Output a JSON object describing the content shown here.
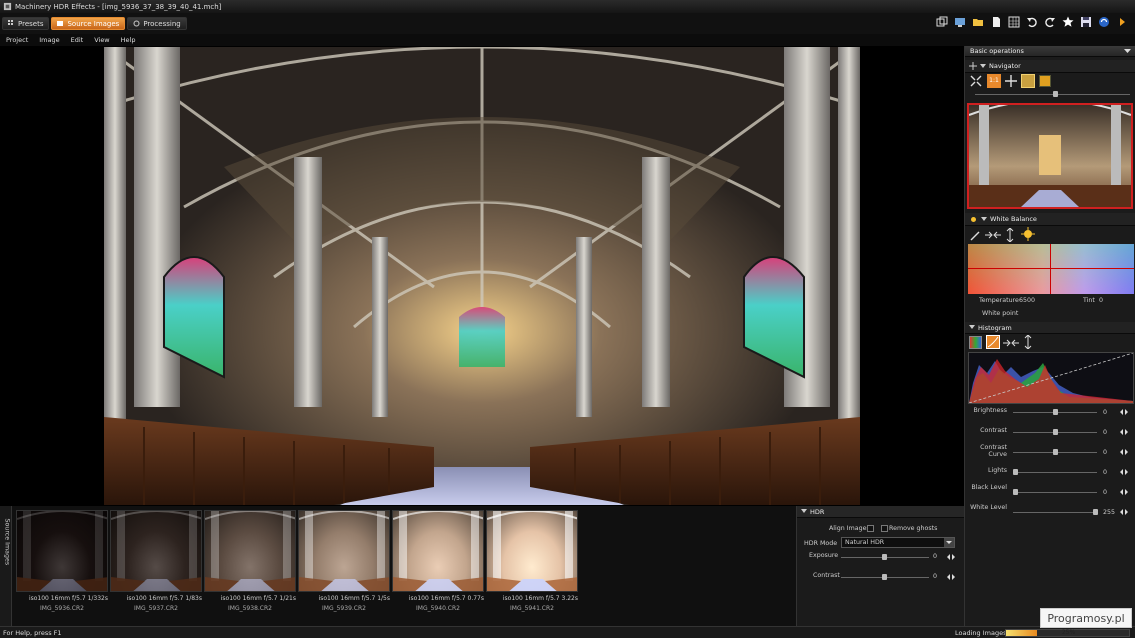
{
  "window": {
    "title": "Machinery HDR Effects - [img_5936_37_38_39_40_41.mch]"
  },
  "tabs": [
    {
      "label": "Presets",
      "active": false
    },
    {
      "label": "Source Images",
      "active": true
    },
    {
      "label": "Processing",
      "active": false
    }
  ],
  "toolbar_icons": [
    "restore-window-icon",
    "monitor-icon",
    "open-folder-icon",
    "new-document-icon",
    "crop-grid-icon",
    "undo-icon",
    "redo-icon",
    "star-icon",
    "save-icon",
    "process-icon",
    "play-arrow-icon"
  ],
  "menu": [
    "Project",
    "Image",
    "Edit",
    "View",
    "Help"
  ],
  "right_panel": {
    "dropdown": "Basic operations",
    "navigator": {
      "title": "Navigator",
      "zoom_level": 0.52
    },
    "white_balance": {
      "title": "White Balance",
      "temperature_label": "Temperature",
      "temperature_value": "6500",
      "tint_label": "Tint",
      "tint_value": "0",
      "white_point_label": "White point"
    },
    "histogram": {
      "title": "Histogram",
      "sliders": [
        {
          "label": "Brightness",
          "value": "0",
          "level": 0.5
        },
        {
          "label": "Contrast",
          "value": "0",
          "level": 0.5
        },
        {
          "label": "Contrast Curve",
          "value": "0",
          "level": 0.5
        },
        {
          "label": "Lights",
          "value": "0",
          "level": 0.0
        },
        {
          "label": "Black Level",
          "value": "0",
          "level": 0.0
        },
        {
          "label": "White Level",
          "value": "255",
          "level": 1.0
        }
      ]
    }
  },
  "source_images_tab": "Source Images",
  "thumbnails": [
    {
      "meta": "iso100  16mm  f/5.7  1/332s",
      "name": "IMG_5936.CR2",
      "exposure": 0.05
    },
    {
      "meta": "iso100  16mm  f/5.7  1/83s",
      "name": "IMG_5937.CR2",
      "exposure": 0.15
    },
    {
      "meta": "iso100  16mm  f/5.7  1/21s",
      "name": "IMG_5938.CR2",
      "exposure": 0.35
    },
    {
      "meta": "iso100  16mm  f/5.7  1/5s",
      "name": "IMG_5939.CR2",
      "exposure": 0.6
    },
    {
      "meta": "iso100  16mm  f/5.7  0.77s",
      "name": "IMG_5940.CR2",
      "exposure": 0.8
    },
    {
      "meta": "iso100  16mm  f/5.7  3.22s",
      "name": "IMG_5941.CR2",
      "exposure": 0.95
    }
  ],
  "hdr": {
    "title": "HDR",
    "align_images": "Align Images",
    "remove_ghosts": "Remove ghosts",
    "mode_label": "HDR Mode",
    "mode_value": "Natural HDR",
    "exposure_label": "Exposure",
    "exposure_value": "0",
    "contrast_label": "Contrast",
    "contrast_value": "0"
  },
  "status": {
    "help": "For Help, press F1",
    "loading_label": "Loading Images",
    "progress_text": "25%",
    "progress": 0.25
  },
  "watermark": "Programosy.pl",
  "colors": {
    "accent": "#e8892c",
    "panel": "#1b1b1b",
    "nav_frame": "#d02020"
  }
}
